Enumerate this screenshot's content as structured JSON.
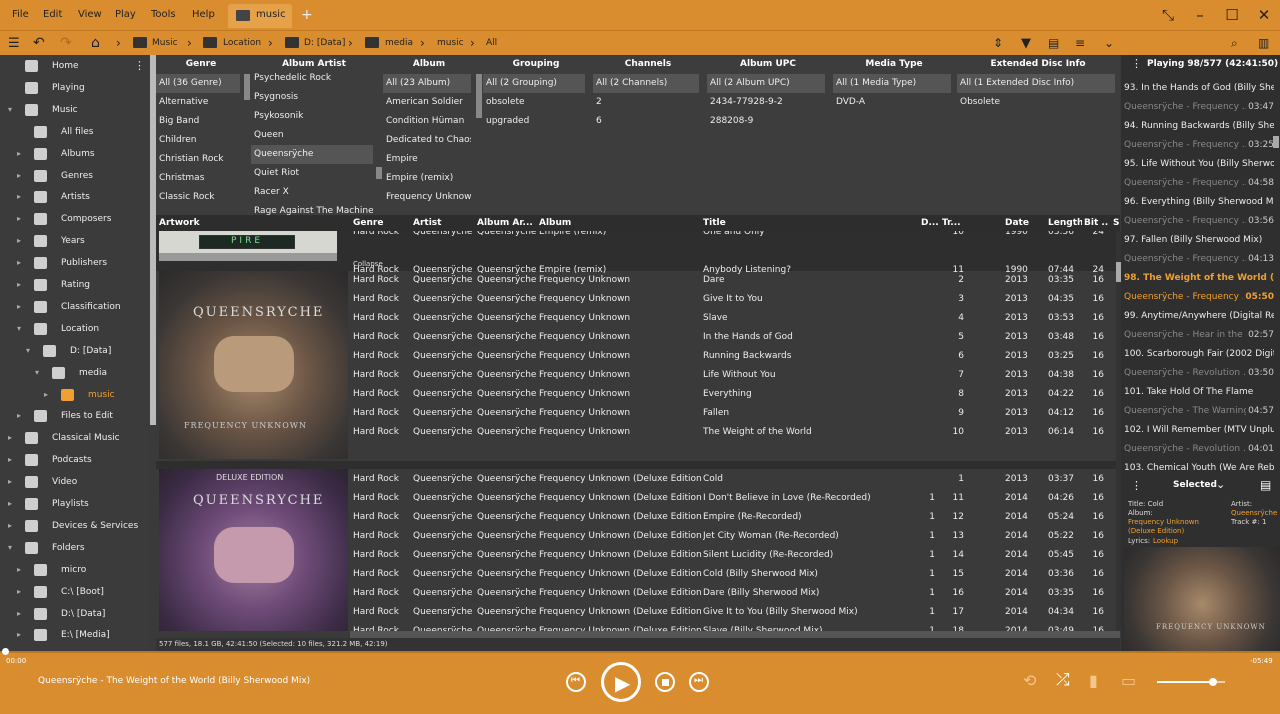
{
  "menu": [
    "File",
    "Edit",
    "View",
    "Play",
    "Tools",
    "Help"
  ],
  "tab": {
    "label": "music"
  },
  "tab_add": "+",
  "breadcrumb": [
    "Music",
    "Location",
    "D: [Data]",
    "media",
    "music",
    "All"
  ],
  "sidebar": [
    {
      "label": "Home",
      "icon": "home-icon",
      "lvl": 0,
      "exp": ""
    },
    {
      "label": "Playing",
      "icon": "music-note-icon",
      "lvl": 0,
      "exp": ""
    },
    {
      "label": "Music",
      "icon": "headphones-icon",
      "lvl": 0,
      "exp": "▾"
    },
    {
      "label": "All files",
      "icon": "music-note-icon",
      "lvl": 1,
      "exp": ""
    },
    {
      "label": "Albums",
      "icon": "disc-icon",
      "lvl": 1,
      "exp": "▸"
    },
    {
      "label": "Genres",
      "icon": "guitar-icon",
      "lvl": 1,
      "exp": "▸"
    },
    {
      "label": "Artists",
      "icon": "person-icon",
      "lvl": 1,
      "exp": "▸"
    },
    {
      "label": "Composers",
      "icon": "pen-icon",
      "lvl": 1,
      "exp": "▸"
    },
    {
      "label": "Years",
      "icon": "calendar-icon",
      "lvl": 1,
      "exp": "▸"
    },
    {
      "label": "Publishers",
      "icon": "building-icon",
      "lvl": 1,
      "exp": "▸"
    },
    {
      "label": "Rating",
      "icon": "star-icon",
      "lvl": 1,
      "exp": "▸"
    },
    {
      "label": "Classification",
      "icon": "grid-icon",
      "lvl": 1,
      "exp": "▸"
    },
    {
      "label": "Location",
      "icon": "folder-icon",
      "lvl": 1,
      "exp": "▾"
    },
    {
      "label": "D: [Data]",
      "icon": "drive-icon",
      "lvl": 2,
      "exp": "▾"
    },
    {
      "label": "media",
      "icon": "folder-icon",
      "lvl": 3,
      "exp": "▾"
    },
    {
      "label": "music",
      "icon": "folder-icon",
      "lvl": 4,
      "exp": "▸"
    },
    {
      "label": "Files to Edit",
      "icon": "pencil-icon",
      "lvl": 1,
      "exp": "▸"
    },
    {
      "label": "Classical Music",
      "icon": "headphones-icon",
      "lvl": 0,
      "exp": "▸"
    },
    {
      "label": "Podcasts",
      "icon": "podcast-icon",
      "lvl": 0,
      "exp": "▸"
    },
    {
      "label": "Video",
      "icon": "film-icon",
      "lvl": 0,
      "exp": "▸"
    },
    {
      "label": "Playlists",
      "icon": "list-icon",
      "lvl": 0,
      "exp": "▸"
    },
    {
      "label": "Devices & Services",
      "icon": "phone-icon",
      "lvl": 0,
      "exp": "▸"
    },
    {
      "label": "Folders",
      "icon": "monitor-icon",
      "lvl": 0,
      "exp": "▾"
    },
    {
      "label": "micro",
      "icon": "folder-icon",
      "lvl": 1,
      "exp": "▸"
    },
    {
      "label": "C:\\ [Boot]",
      "icon": "drive-icon",
      "lvl": 1,
      "exp": "▸"
    },
    {
      "label": "D:\\ [Data]",
      "icon": "drive-icon",
      "lvl": 1,
      "exp": "▸"
    },
    {
      "label": "E:\\ [Media]",
      "icon": "drive-icon",
      "lvl": 1,
      "exp": "▸"
    }
  ],
  "filters": {
    "genre": {
      "header": "Genre",
      "items": [
        "All (36 Genre)",
        "Alternative",
        "Big Band",
        "Children",
        "Christian Rock",
        "Christmas",
        "Classic Rock"
      ]
    },
    "album_artist": {
      "header": "Album Artist",
      "items": [
        "Psychedelic Rock",
        "Psygnosis",
        "Psykosonik",
        "Queen",
        "Queensrÿche",
        "Quiet Riot",
        "Racer X",
        "Rage Against The Machine"
      ]
    },
    "album": {
      "header": "Album",
      "items": [
        "All (23 Album)",
        "American Soldier",
        "Condition Hüman",
        "Dedicated to Chaos",
        "Empire",
        "Empire (remix)",
        "Frequency Unknown"
      ]
    },
    "grouping": {
      "header": "Grouping",
      "items": [
        "All (2 Grouping)",
        "obsolete",
        "upgraded"
      ]
    },
    "channels": {
      "header": "Channels",
      "items": [
        "All (2 Channels)",
        "2",
        "6"
      ]
    },
    "album_upc": {
      "header": "Album UPC",
      "items": [
        "All (2 Album UPC)",
        "2434-77928-9-2",
        "288208-9"
      ]
    },
    "media_type": {
      "header": "Media Type",
      "items": [
        "All (1 Media Type)",
        "DVD-A"
      ]
    },
    "ext_disc": {
      "header": "Extended Disc Info",
      "items": [
        "All (1 Extended Disc Info)",
        "Obsolete"
      ]
    }
  },
  "columns": [
    "Artwork",
    "Genre",
    "Artist",
    "Album Ar...",
    "Album",
    "Title",
    "D...",
    "Tr...",
    "Date",
    "Length",
    "Bit ...",
    "S"
  ],
  "collapse": "Collapse",
  "group_empire": [
    {
      "genre": "Hard Rock",
      "artist": "Queensrÿche",
      "aa": "Queensrÿche",
      "album": "Empire (remix)",
      "title": "One and Only",
      "disc": "",
      "track": "10",
      "date": "1990",
      "len": "03:56",
      "bit": "24"
    },
    {
      "genre": "Hard Rock",
      "artist": "Queensrÿche",
      "aa": "Queensrÿche",
      "album": "Empire (remix)",
      "title": "Anybody Listening?",
      "disc": "",
      "track": "11",
      "date": "1990",
      "len": "07:44",
      "bit": "24"
    }
  ],
  "group_fu": [
    {
      "genre": "Hard Rock",
      "artist": "Queensrÿche",
      "aa": "Queensrÿche",
      "album": "Frequency Unknown",
      "title": "Dare",
      "disc": "",
      "track": "2",
      "date": "2013",
      "len": "03:35",
      "bit": "16"
    },
    {
      "genre": "Hard Rock",
      "artist": "Queensrÿche",
      "aa": "Queensrÿche",
      "album": "Frequency Unknown",
      "title": "Give It to You",
      "disc": "",
      "track": "3",
      "date": "2013",
      "len": "04:35",
      "bit": "16"
    },
    {
      "genre": "Hard Rock",
      "artist": "Queensrÿche",
      "aa": "Queensrÿche",
      "album": "Frequency Unknown",
      "title": "Slave",
      "disc": "",
      "track": "4",
      "date": "2013",
      "len": "03:53",
      "bit": "16"
    },
    {
      "genre": "Hard Rock",
      "artist": "Queensrÿche",
      "aa": "Queensrÿche",
      "album": "Frequency Unknown",
      "title": "In the Hands of God",
      "disc": "",
      "track": "5",
      "date": "2013",
      "len": "03:48",
      "bit": "16"
    },
    {
      "genre": "Hard Rock",
      "artist": "Queensrÿche",
      "aa": "Queensrÿche",
      "album": "Frequency Unknown",
      "title": "Running Backwards",
      "disc": "",
      "track": "6",
      "date": "2013",
      "len": "03:25",
      "bit": "16"
    },
    {
      "genre": "Hard Rock",
      "artist": "Queensrÿche",
      "aa": "Queensrÿche",
      "album": "Frequency Unknown",
      "title": "Life Without You",
      "disc": "",
      "track": "7",
      "date": "2013",
      "len": "04:38",
      "bit": "16"
    },
    {
      "genre": "Hard Rock",
      "artist": "Queensrÿche",
      "aa": "Queensrÿche",
      "album": "Frequency Unknown",
      "title": "Everything",
      "disc": "",
      "track": "8",
      "date": "2013",
      "len": "04:22",
      "bit": "16"
    },
    {
      "genre": "Hard Rock",
      "artist": "Queensrÿche",
      "aa": "Queensrÿche",
      "album": "Frequency Unknown",
      "title": "Fallen",
      "disc": "",
      "track": "9",
      "date": "2013",
      "len": "04:12",
      "bit": "16"
    },
    {
      "genre": "Hard Rock",
      "artist": "Queensrÿche",
      "aa": "Queensrÿche",
      "album": "Frequency Unknown",
      "title": "The Weight of the World",
      "disc": "",
      "track": "10",
      "date": "2013",
      "len": "06:14",
      "bit": "16"
    }
  ],
  "group_fud": [
    {
      "genre": "Hard Rock",
      "artist": "Queensrÿche",
      "aa": "Queensrÿche",
      "album": "Frequency Unknown (Deluxe Edition)",
      "title": "Cold",
      "disc": "",
      "track": "1",
      "date": "2013",
      "len": "03:37",
      "bit": "16"
    },
    {
      "genre": "Hard Rock",
      "artist": "Queensrÿche",
      "aa": "Queensrÿche",
      "album": "Frequency Unknown (Deluxe Edition)",
      "title": "I Don't Believe in Love (Re-Recorded)",
      "disc": "1",
      "track": "11",
      "date": "2014",
      "len": "04:26",
      "bit": "16"
    },
    {
      "genre": "Hard Rock",
      "artist": "Queensrÿche",
      "aa": "Queensrÿche",
      "album": "Frequency Unknown (Deluxe Edition)",
      "title": "Empire (Re-Recorded)",
      "disc": "1",
      "track": "12",
      "date": "2014",
      "len": "05:24",
      "bit": "16"
    },
    {
      "genre": "Hard Rock",
      "artist": "Queensrÿche",
      "aa": "Queensrÿche",
      "album": "Frequency Unknown (Deluxe Edition)",
      "title": "Jet City Woman (Re-Recorded)",
      "disc": "1",
      "track": "13",
      "date": "2014",
      "len": "05:22",
      "bit": "16"
    },
    {
      "genre": "Hard Rock",
      "artist": "Queensrÿche",
      "aa": "Queensrÿche",
      "album": "Frequency Unknown (Deluxe Edition)",
      "title": "Silent Lucidity (Re-Recorded)",
      "disc": "1",
      "track": "14",
      "date": "2014",
      "len": "05:45",
      "bit": "16"
    },
    {
      "genre": "Hard Rock",
      "artist": "Queensrÿche",
      "aa": "Queensrÿche",
      "album": "Frequency Unknown (Deluxe Edition)",
      "title": "Cold (Billy Sherwood Mix)",
      "disc": "1",
      "track": "15",
      "date": "2014",
      "len": "03:36",
      "bit": "16"
    },
    {
      "genre": "Hard Rock",
      "artist": "Queensrÿche",
      "aa": "Queensrÿche",
      "album": "Frequency Unknown (Deluxe Edition)",
      "title": "Dare (Billy Sherwood Mix)",
      "disc": "1",
      "track": "16",
      "date": "2014",
      "len": "03:35",
      "bit": "16"
    },
    {
      "genre": "Hard Rock",
      "artist": "Queensrÿche",
      "aa": "Queensrÿche",
      "album": "Frequency Unknown (Deluxe Edition)",
      "title": "Give It to You (Billy Sherwood Mix)",
      "disc": "1",
      "track": "17",
      "date": "2014",
      "len": "04:34",
      "bit": "16"
    },
    {
      "genre": "Hard Rock",
      "artist": "Queensrÿche",
      "aa": "Queensrÿche",
      "album": "Frequency Unknown (Deluxe Edition)",
      "title": "Slave (Billy Sherwood Mix)",
      "disc": "1",
      "track": "18",
      "date": "2014",
      "len": "03:49",
      "bit": "16"
    }
  ],
  "art": {
    "pire": "PIRE",
    "fu_title": "QUEENSRYCHE",
    "fu_sub": "FREQUENCY UNKNOWN",
    "deluxe": "DELUXE EDITION"
  },
  "status": "577 files, 18.1 GB, 42:41:50 (Selected: 10 files, 321.2 MB, 42:19)",
  "now_playing": {
    "header": "Playing 98/577 (42:41:50)",
    "items": [
      {
        "t": "93.  In the Hands of God (Billy She...",
        "tm": "",
        "kind": "title"
      },
      {
        "t": "Queensrÿche - Frequency ...",
        "tm": "03:47",
        "kind": "sub"
      },
      {
        "t": "94.  Running Backwards (Billy She...",
        "tm": "",
        "kind": "title"
      },
      {
        "t": "Queensrÿche - Frequency ...",
        "tm": "03:25",
        "kind": "sub"
      },
      {
        "t": "95.  Life Without You (Billy Sherwo...",
        "tm": "",
        "kind": "title"
      },
      {
        "t": "Queensrÿche - Frequency ...",
        "tm": "04:58",
        "kind": "sub"
      },
      {
        "t": "96.  Everything (Billy Sherwood Mi...",
        "tm": "",
        "kind": "title"
      },
      {
        "t": "Queensrÿche - Frequency ...",
        "tm": "03:56",
        "kind": "sub"
      },
      {
        "t": "97.  Fallen (Billy Sherwood Mix)",
        "tm": "",
        "kind": "title"
      },
      {
        "t": "Queensrÿche - Frequency ...",
        "tm": "04:13",
        "kind": "sub"
      },
      {
        "t": "98.  The Weight of the World (Billy ...",
        "tm": "",
        "kind": "cur"
      },
      {
        "t": "Queensrÿche - Frequency ...",
        "tm": "05:50",
        "kind": "cursub"
      },
      {
        "t": "99.  Anytime/Anywhere (Digital Re...",
        "tm": "",
        "kind": "title"
      },
      {
        "t": "Queensrÿche - Hear in the ...",
        "tm": "02:57",
        "kind": "sub"
      },
      {
        "t": "100.  Scarborough Fair (2002 Digit...",
        "tm": "",
        "kind": "title"
      },
      {
        "t": "Queensrÿche - Revolution ...",
        "tm": "03:50",
        "kind": "sub"
      },
      {
        "t": "101.  Take Hold Of The Flame",
        "tm": "",
        "kind": "title"
      },
      {
        "t": "Queensrÿche - The Warning",
        "tm": "04:57",
        "kind": "sub"
      },
      {
        "t": "102.  I Will Remember (MTV Unplu...",
        "tm": "",
        "kind": "title"
      },
      {
        "t": "Queensrÿche - Revolution ...",
        "tm": "04:01",
        "kind": "sub"
      },
      {
        "t": "103.  Chemical Youth (We Are Reb...",
        "tm": "",
        "kind": "title"
      }
    ]
  },
  "selected": {
    "header": "Selected",
    "title": "Title: Cold",
    "album_label": "Album:",
    "album_val": "Frequency Unknown (Deluxe Edition)",
    "lyrics_label": "Lyrics:",
    "lyrics_val": "Lookup",
    "artist_label": "Artist:",
    "artist_val": "Queensrÿche",
    "track": "Track #: 1"
  },
  "player": {
    "elapsed": "00:00",
    "remaining": "-05:49",
    "now": "Queensrÿche - The Weight of the World (Billy Sherwood Mix)",
    "volume": 0.82
  },
  "colors": {
    "accent": "#d98d2e",
    "current": "#f0a030"
  }
}
